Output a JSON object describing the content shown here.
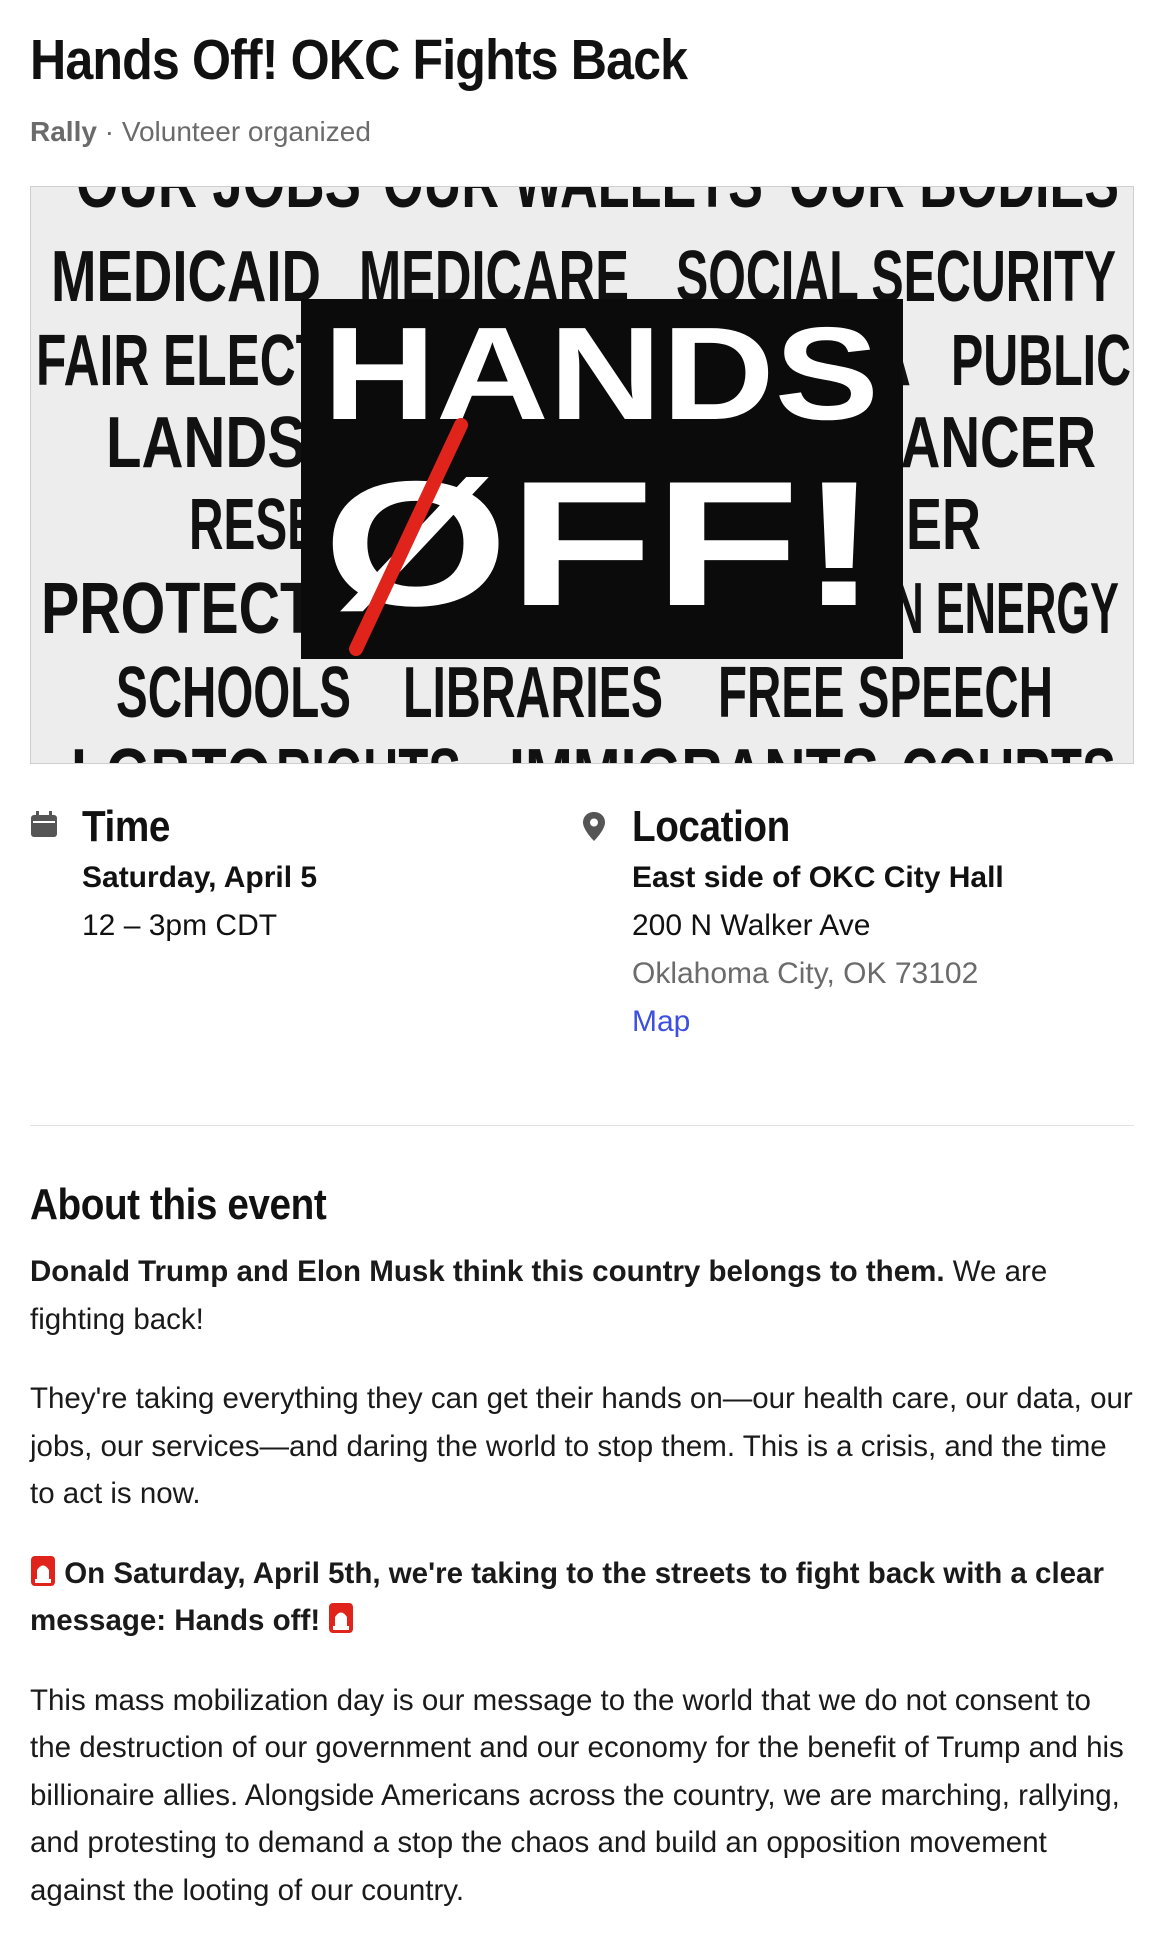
{
  "event": {
    "title": "Hands Off! OKC Fights Back",
    "type": "Rally",
    "separator": " · ",
    "organizer": "Volunteer organized"
  },
  "banner": {
    "rows": [
      [
        "OUR JOBS",
        "OUR WALLETS",
        "OUR BODIES"
      ],
      [
        "MEDICAID",
        "MEDICARE",
        "SOCIAL SECURITY"
      ],
      [
        "FAIR ELECT",
        "A",
        "PUBLIC"
      ],
      [
        "LANDS",
        "CANCER"
      ],
      [
        "RESE",
        "MER"
      ],
      [
        "PROTECTI",
        "AN ENERGY"
      ],
      [
        "SCHOOLS",
        "LIBRARIES",
        "FREE SPEECH"
      ],
      [
        "LGBTQ",
        "RIGHTS",
        "IMMIGRANTS",
        "COURTS"
      ]
    ],
    "headline_top": "HANDS",
    "headline_bottom": "ØFF!"
  },
  "time": {
    "heading": "Time",
    "icon": "calendar-icon",
    "date": "Saturday, April 5",
    "hours": "12 – 3pm CDT"
  },
  "location": {
    "heading": "Location",
    "icon": "map-pin-icon",
    "venue": "East side of OKC City Hall",
    "street": "200 N Walker Ave",
    "city": "Oklahoma City, OK 73102",
    "map_link": "Map",
    "link_color": "#3d4fe0"
  },
  "about": {
    "heading": "About this event",
    "p1_bold": "Donald Trump and Elon Musk think this country belongs to them.",
    "p1_rest": " We are fighting back!",
    "p2": "They're taking everything they can get their hands on—our health care, our data, our jobs, our services—and daring the world to stop them. This is a crisis, and the time to act is now.",
    "p3_bold": " On Saturday, April 5th, we're taking to the streets to fight back with a clear message: Hands off! ",
    "p4": "This mass mobilization day is our message to the world that we do not consent to the destruction of our government and our economy for the benefit of Trump and his billionaire allies. Alongside Americans across the country, we are marching, rallying, and protesting to demand a stop the chaos and build an opposition movement against the looting of our country."
  },
  "colors": {
    "accent_red": "#e0241b",
    "muted_text": "#6b6b6b"
  }
}
